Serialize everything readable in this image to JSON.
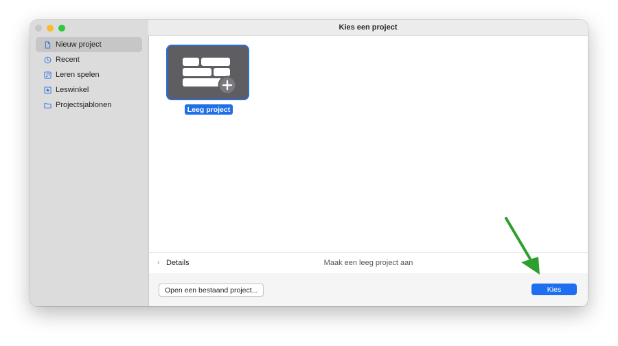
{
  "window": {
    "title": "Kies een project"
  },
  "sidebar": {
    "items": [
      {
        "label": "Nieuw project",
        "icon": "document-icon",
        "selected": true
      },
      {
        "label": "Recent",
        "icon": "clock-icon",
        "selected": false
      },
      {
        "label": "Leren spelen",
        "icon": "music-note-icon",
        "selected": false
      },
      {
        "label": "Leswinkel",
        "icon": "star-icon",
        "selected": false
      },
      {
        "label": "Projectsjablonen",
        "icon": "folder-icon",
        "selected": false
      }
    ]
  },
  "main": {
    "templates": [
      {
        "label": "Leeg project",
        "icon": "empty-project-icon",
        "selected": true
      }
    ]
  },
  "details": {
    "label": "Details",
    "description": "Maak een leeg project aan"
  },
  "footer": {
    "open_label": "Open een bestaand project...",
    "choose_label": "Kies"
  },
  "colors": {
    "accent": "#1d6ff0",
    "annotation_arrow": "#2e9e2e"
  }
}
